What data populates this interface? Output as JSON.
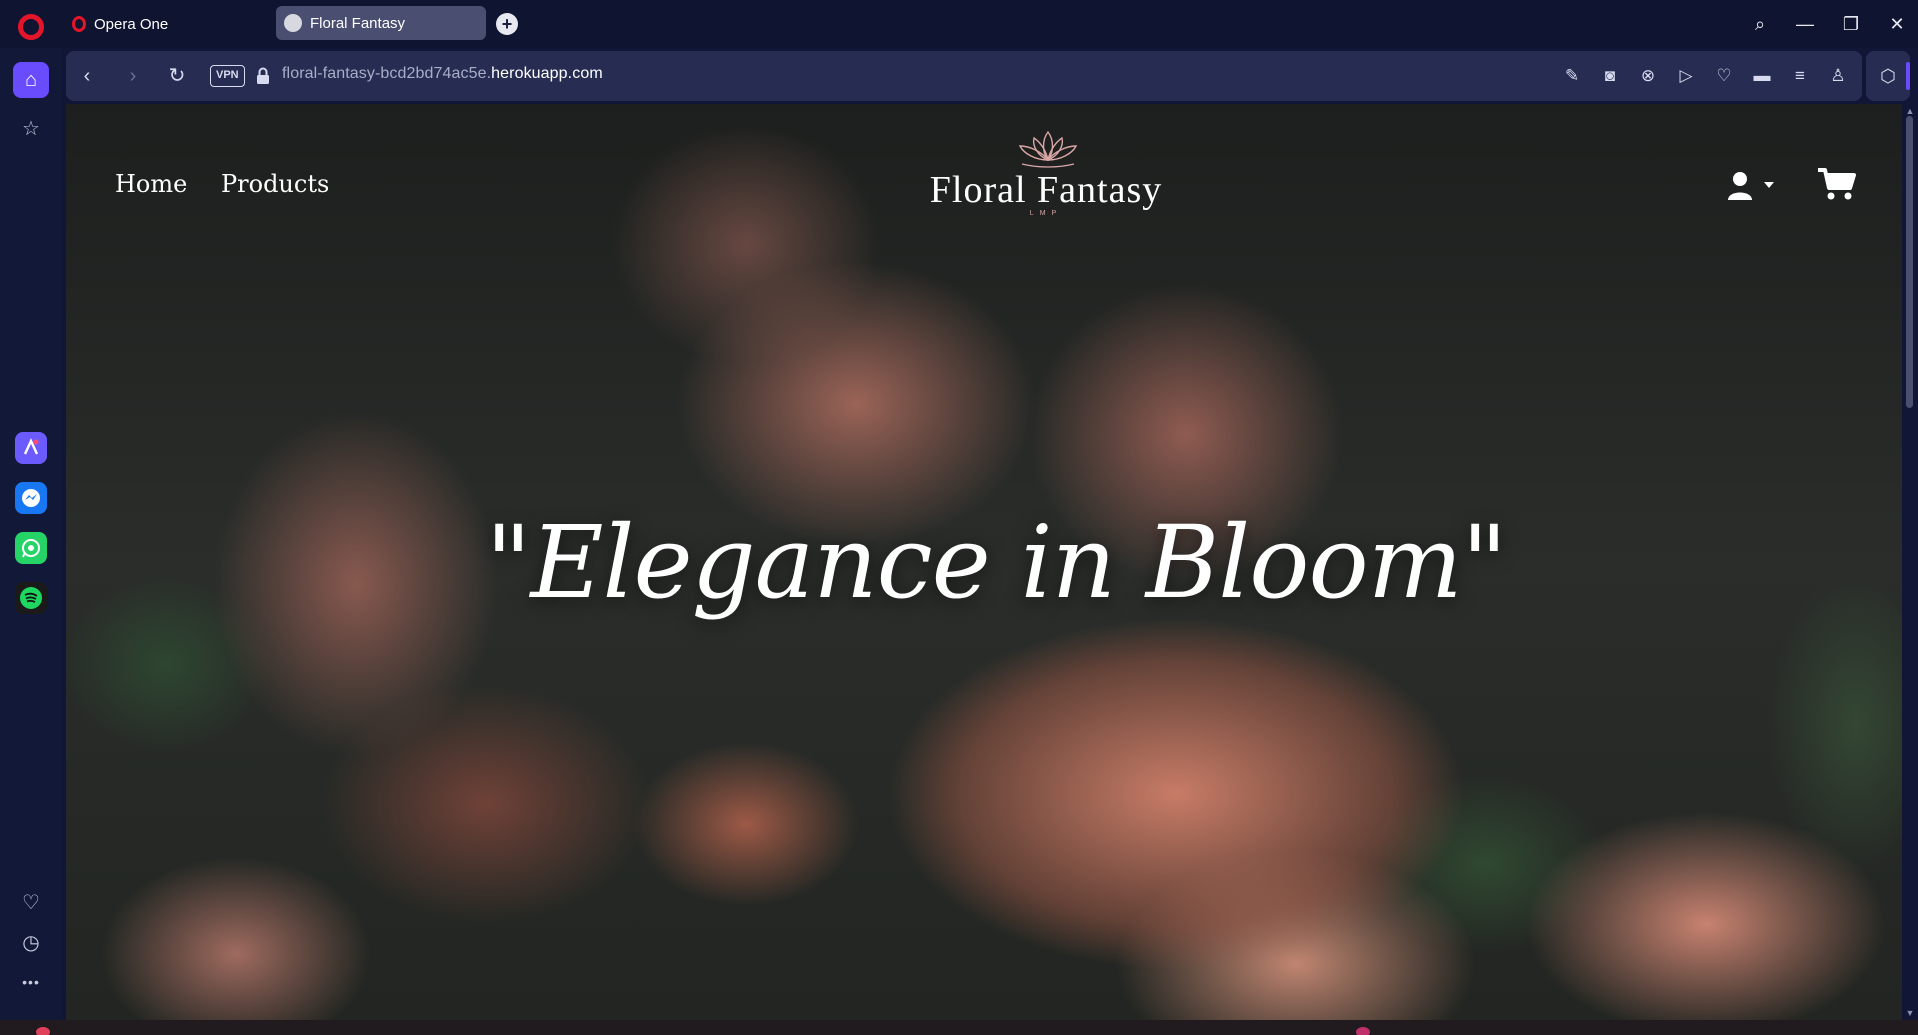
{
  "browser": {
    "product_tab_label": "Opera One",
    "active_tab_title": "Floral Fantasy",
    "new_tab_symbol": "+",
    "window_controls": {
      "search": "⌕",
      "minimize": "—",
      "restore": "❐",
      "close": "✕"
    }
  },
  "addressbar": {
    "back_symbol": "‹",
    "forward_symbol": "›",
    "reload_symbol": "↻",
    "vpn_label": "VPN",
    "url_prefix": "floral-fantasy-bcd2bd74ac5e.",
    "url_domain": "herokuapp.com",
    "toolbar_icons": [
      "edit-icon",
      "camera-icon",
      "adblock-icon",
      "play-icon",
      "heart-icon",
      "battery-icon",
      "settings-icon",
      "profile-icon"
    ],
    "toolbar_glyphs": [
      "✎",
      "◙",
      "⊗",
      "▷",
      "♡",
      "▬",
      "≡",
      "♙"
    ],
    "extensions_glyph": "⬡"
  },
  "sidebar": {
    "home_glyph": "⌂",
    "pinboard_glyph": "☆",
    "apps": [
      {
        "name": "aria-app",
        "color": "#6b5bff"
      },
      {
        "name": "messenger-app",
        "color": "#1877f2"
      },
      {
        "name": "whatsapp-app",
        "color": "#25d366"
      },
      {
        "name": "spotify-app",
        "color": "#1ed760"
      }
    ],
    "bottom_glyphs": {
      "favorites": "♡",
      "history": "◷",
      "more": "•••"
    }
  },
  "site": {
    "nav": {
      "home": "Home",
      "products": "Products"
    },
    "brand": {
      "name": "Floral Fantasy",
      "subtitle": "LMP",
      "accent_color": "#d9a6a6"
    },
    "hero_text": "\"Elegance in Bloom\""
  }
}
